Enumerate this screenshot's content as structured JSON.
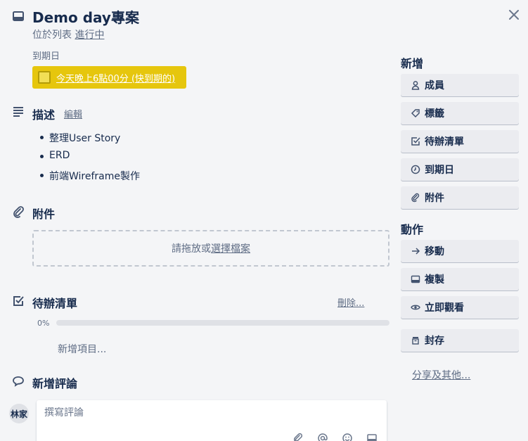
{
  "card": {
    "title": "Demo day專案",
    "in_list_prefix": "位於列表",
    "list_name": "進行中"
  },
  "due": {
    "label": "到期日",
    "value": "今天晚上6點00分 (快到期的)",
    "color": "#e6c60d"
  },
  "description": {
    "title": "描述",
    "edit_label": "編輯",
    "items": [
      "整理User Story",
      "ERD",
      "前端Wireframe製作"
    ]
  },
  "attachments": {
    "title": "附件",
    "drop_text": "請拖放或",
    "select_link": "選擇檔案"
  },
  "checklist": {
    "title": "待辦清單",
    "delete_label": "刪除...",
    "percent_label": "0%",
    "progress": 0,
    "add_item": "新增項目..."
  },
  "comments": {
    "title": "新增評論",
    "avatar_text": "林家",
    "placeholder": "撰寫評論",
    "tools": [
      "attachment-icon",
      "mention-icon",
      "emoji-icon",
      "card-icon"
    ]
  },
  "sidebar": {
    "add_heading": "新增",
    "add_items": [
      {
        "label": "成員",
        "icon": "person-icon"
      },
      {
        "label": "標籤",
        "icon": "tag-icon"
      },
      {
        "label": "待辦清單",
        "icon": "checkbox-icon"
      },
      {
        "label": "到期日",
        "icon": "clock-icon"
      },
      {
        "label": "附件",
        "icon": "paperclip-icon"
      }
    ],
    "actions_heading": "動作",
    "action_items": [
      {
        "label": "移動",
        "icon": "arrow-right-icon"
      },
      {
        "label": "複製",
        "icon": "card-icon"
      },
      {
        "label": "立即觀看",
        "icon": "eye-icon"
      },
      {
        "label": "封存",
        "icon": "archive-icon"
      }
    ],
    "share_label": "分享及其他..."
  }
}
